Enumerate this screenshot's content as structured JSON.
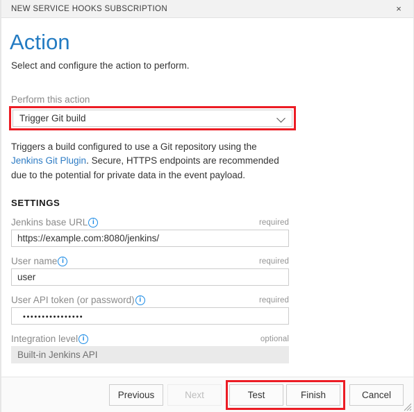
{
  "titlebar": {
    "title": "NEW SERVICE HOOKS SUBSCRIPTION",
    "close_label": "×"
  },
  "header": {
    "title": "Action",
    "subtitle": "Select and configure the action to perform."
  },
  "action_select": {
    "label": "Perform this action",
    "selected": "Trigger Git build",
    "chevron": "chevron-down-icon",
    "highlight_color": "#ec1c24"
  },
  "description": {
    "part1": "Triggers a build configured to use a Git repository using the ",
    "link": "Jenkins Git Plugin",
    "part2": ". Secure, HTTPS endpoints are recommended due to the potential for private data in the event payload.",
    "link_color": "#2e7cc4"
  },
  "settings": {
    "heading": "SETTINGS",
    "fields": [
      {
        "label": "Jenkins base URL",
        "info": "i",
        "requirement": "required",
        "value": "https://example.com:8080/jenkins/",
        "type": "text",
        "disabled": false
      },
      {
        "label": "User name",
        "info": "i",
        "requirement": "required",
        "value": "user",
        "type": "text",
        "disabled": false
      },
      {
        "label": "User API token (or password)",
        "info": "i",
        "requirement": "required",
        "value": "••••••••••••••••",
        "type": "password",
        "disabled": false
      },
      {
        "label": "Integration level",
        "info": "i",
        "requirement": "optional",
        "value": "Built-in Jenkins API",
        "type": "text",
        "disabled": true
      }
    ]
  },
  "footer": {
    "previous_label": "Previous",
    "next_label": "Next",
    "test_label": "Test",
    "finish_label": "Finish",
    "cancel_label": "Cancel",
    "highlight_color": "#ec1c24"
  }
}
